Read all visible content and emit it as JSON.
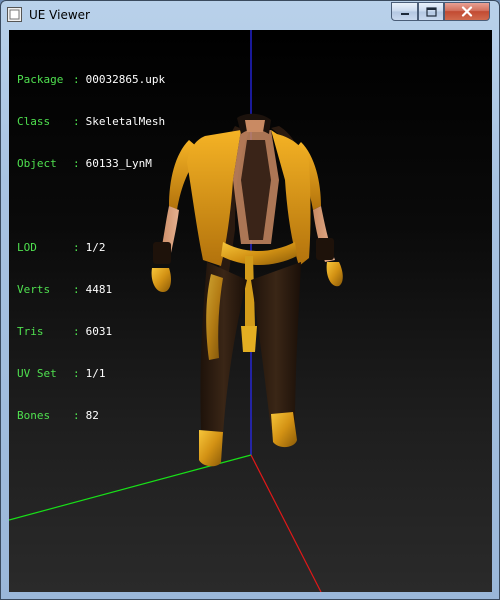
{
  "window": {
    "title": "UE Viewer"
  },
  "info": {
    "package": {
      "label": "Package",
      "value": "00032865.upk"
    },
    "class": {
      "label": "Class",
      "value": "SkeletalMesh"
    },
    "object": {
      "label": "Object",
      "value": "60133_LynM"
    },
    "lod": {
      "label": "LOD",
      "value": "1/2"
    },
    "verts": {
      "label": "Verts",
      "value": "4481"
    },
    "tris": {
      "label": "Tris",
      "value": "6031"
    },
    "uvset": {
      "label": "UV Set",
      "value": "1/1"
    },
    "bones": {
      "label": "Bones",
      "value": "82"
    }
  },
  "colors": {
    "label_green": "#4fe04f",
    "axis_x": "#ff2020",
    "axis_y": "#20ff20",
    "axis_z": "#2020ff",
    "gold": "#e0a010",
    "dark_cloth": "#2a1a10"
  },
  "icons": [
    "app-icon",
    "minimize-icon",
    "maximize-icon",
    "close-icon"
  ]
}
